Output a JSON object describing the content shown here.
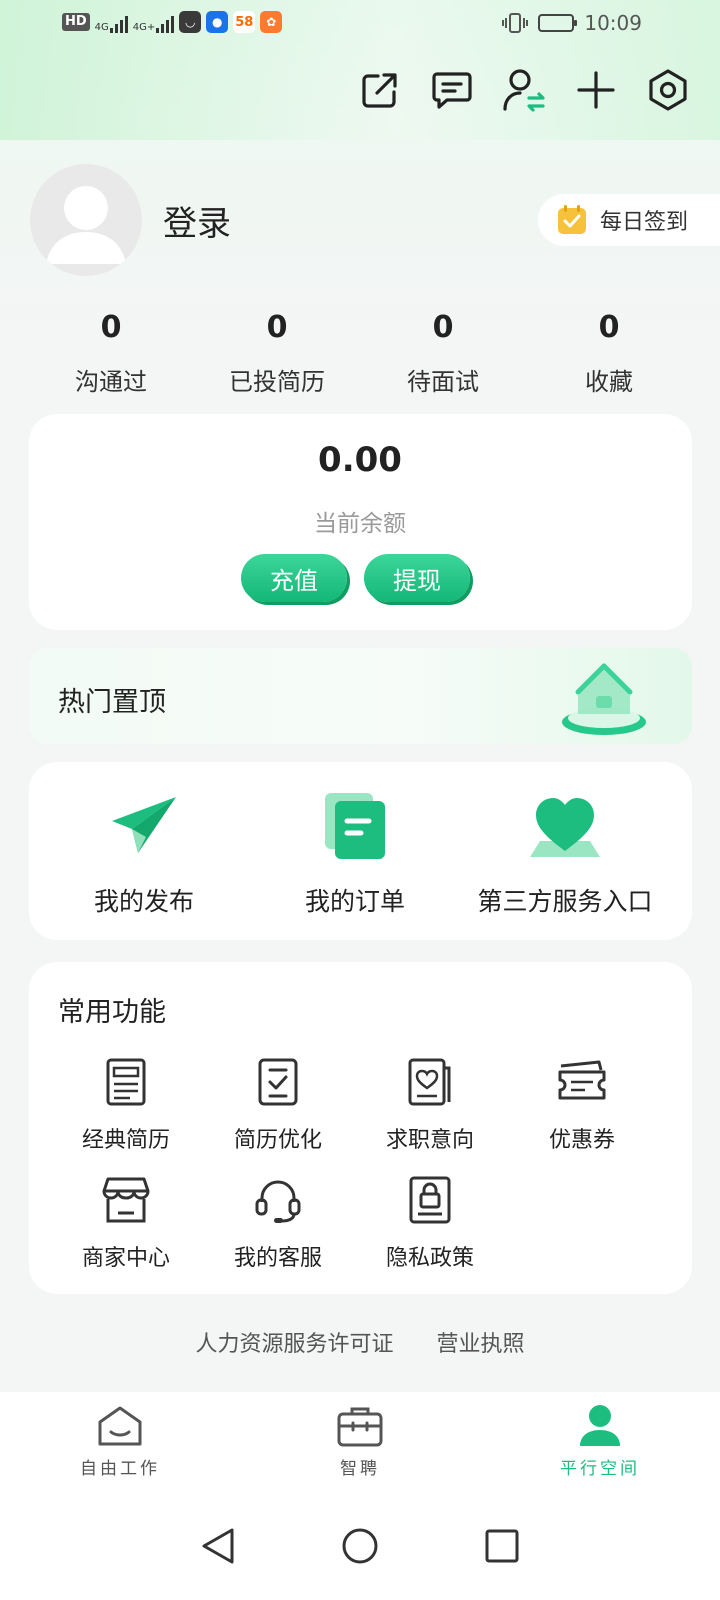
{
  "status_bar": {
    "hd_label": "HD",
    "net1": "4G",
    "net2": "4G+",
    "app_58": "58",
    "time": "10:09"
  },
  "profile": {
    "login_label": "登录",
    "checkin_label": "每日签到"
  },
  "stats": [
    {
      "value": "0",
      "label": "沟通过"
    },
    {
      "value": "0",
      "label": "已投简历"
    },
    {
      "value": "0",
      "label": "待面试"
    },
    {
      "value": "0",
      "label": "收藏"
    }
  ],
  "wallet": {
    "balance": "0.00",
    "balance_label": "当前余额",
    "recharge_label": "充值",
    "withdraw_label": "提现"
  },
  "hot": {
    "title": "热门置顶"
  },
  "quick_entries": [
    {
      "label": "我的发布",
      "icon": "paper-plane-icon"
    },
    {
      "label": "我的订单",
      "icon": "order-document-icon"
    },
    {
      "label": "第三方服务入口",
      "icon": "heart-icon"
    }
  ],
  "common_functions": {
    "title": "常用功能",
    "items": [
      {
        "label": "经典简历",
        "icon": "resume-icon"
      },
      {
        "label": "简历优化",
        "icon": "resume-check-icon"
      },
      {
        "label": "求职意向",
        "icon": "job-intention-icon"
      },
      {
        "label": "优惠券",
        "icon": "coupon-icon"
      },
      {
        "label": "商家中心",
        "icon": "store-icon"
      },
      {
        "label": "我的客服",
        "icon": "headset-icon"
      },
      {
        "label": "隐私政策",
        "icon": "privacy-lock-icon"
      }
    ]
  },
  "footer": {
    "license_label": "人力资源服务许可证",
    "business_label": "营业执照"
  },
  "tabs": [
    {
      "label": "自由工作",
      "icon": "home-icon",
      "active": false
    },
    {
      "label": "智聘",
      "icon": "briefcase-icon",
      "active": false
    },
    {
      "label": "平行空间",
      "icon": "person-icon",
      "active": true
    }
  ],
  "colors": {
    "accent": "#1cbd7f",
    "accent_dark": "#0f9d61",
    "background": "#f4f5f5"
  }
}
